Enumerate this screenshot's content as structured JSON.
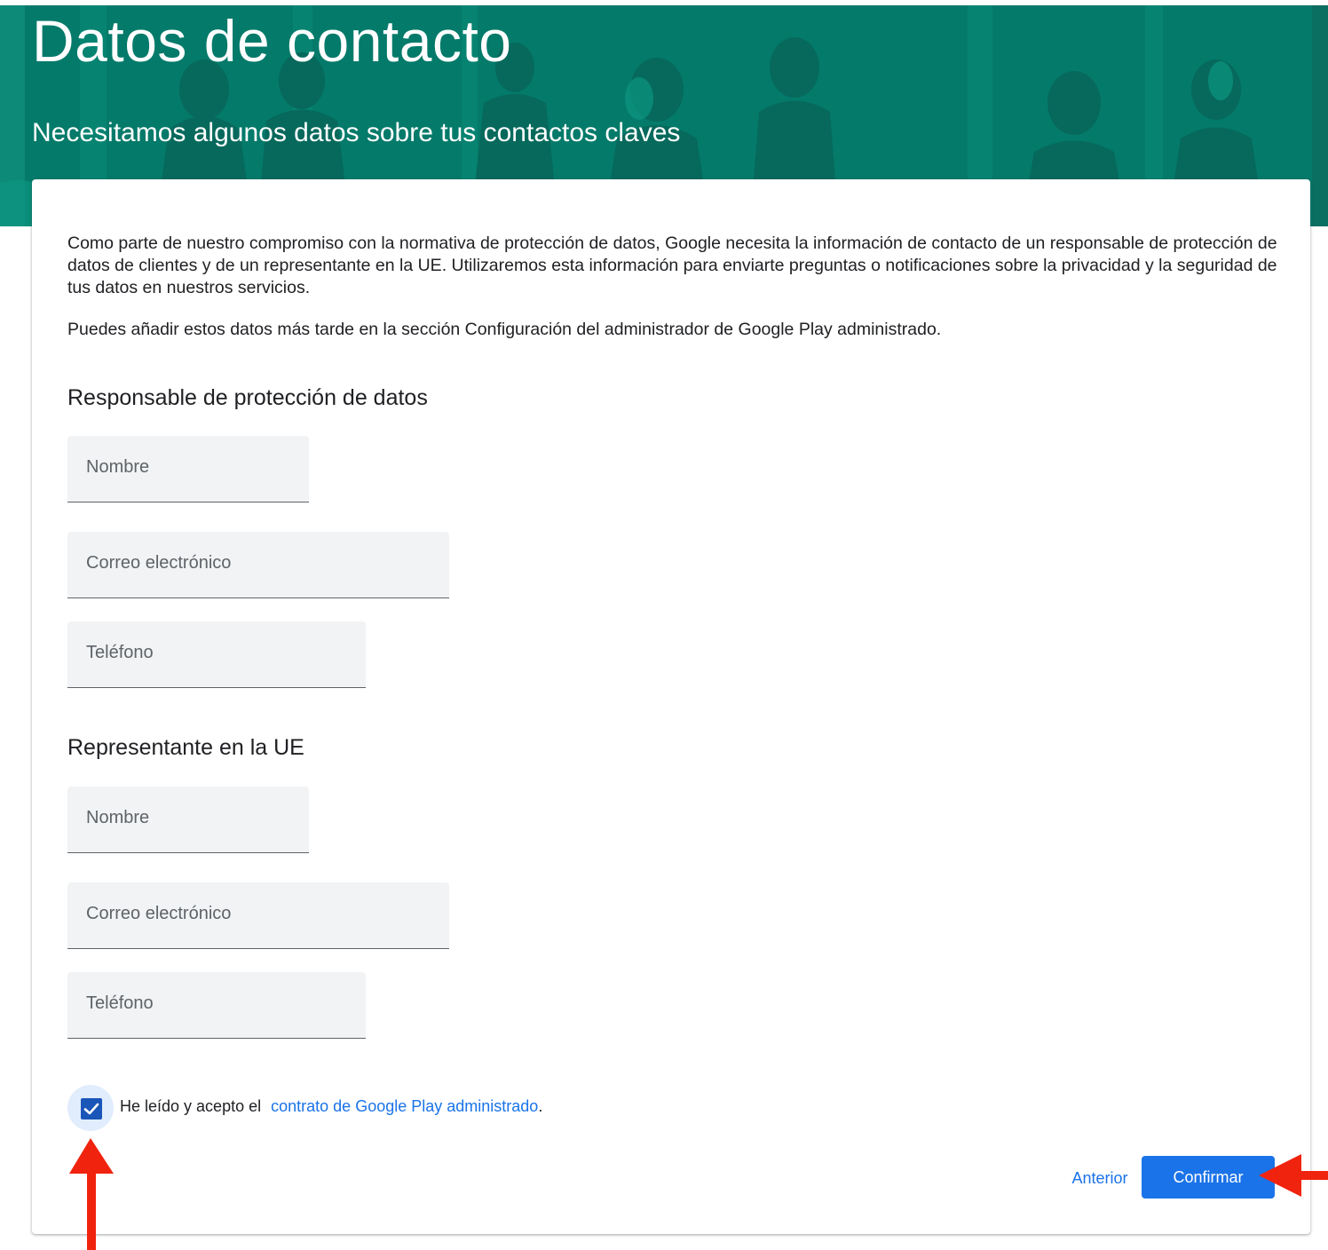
{
  "header": {
    "title": "Datos de contacto",
    "subtitle": "Necesitamos algunos datos sobre tus contactos claves"
  },
  "intro": {
    "paragraph1": "Como parte de nuestro compromiso con la normativa de protección de datos, Google necesita la información de contacto de un responsable de protección de datos de clientes y de un representante en la UE. Utilizaremos esta información para enviarte preguntas o notificaciones sobre la privacidad y la seguridad de tus datos en nuestros servicios.",
    "paragraph2": "Puedes añadir estos datos más tarde en la sección Configuración del administrador de Google Play administrado."
  },
  "dpo_section": {
    "title": "Responsable de protección de datos",
    "name_placeholder": "Nombre",
    "email_placeholder": "Correo electrónico",
    "phone_placeholder": "Teléfono"
  },
  "eu_section": {
    "title": "Representante en la UE",
    "name_placeholder": "Nombre",
    "email_placeholder": "Correo electrónico",
    "phone_placeholder": "Teléfono"
  },
  "agreement": {
    "checked": true,
    "text": "He leído y acepto el",
    "link_text": "contrato de Google Play administrado",
    "suffix": "."
  },
  "actions": {
    "back_label": "Anterior",
    "confirm_label": "Confirmar"
  },
  "colors": {
    "header_bg": "#047a6a",
    "accent": "#1a73e8",
    "checkbox": "#1a56b8",
    "annotation_arrow": "#f0230f"
  }
}
